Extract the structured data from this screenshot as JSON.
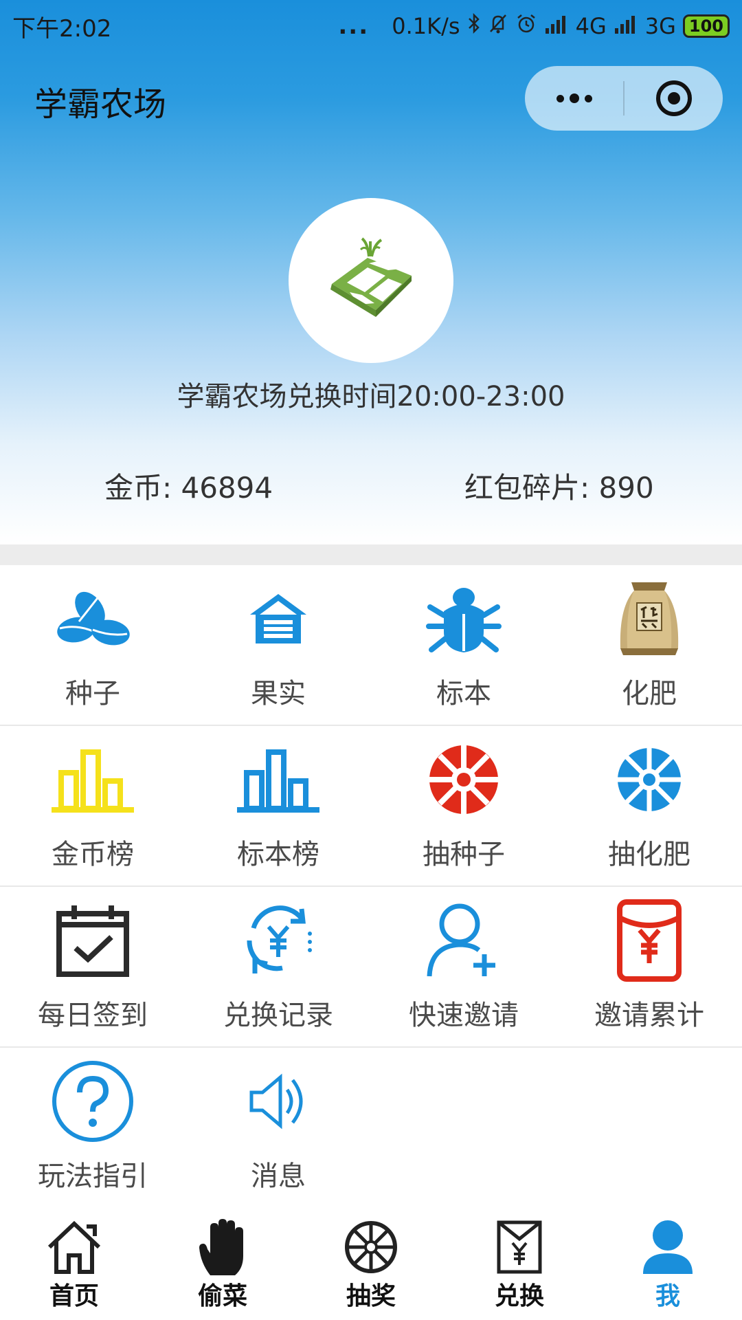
{
  "status_bar": {
    "time": "下午2:02",
    "dots": "...",
    "net_speed": "0.1K/s",
    "signal1": "4G",
    "signal2": "3G",
    "battery": "100"
  },
  "nav": {
    "title": "学霸农场"
  },
  "hero": {
    "exchange_time": "学霸农场兑换时间20:00-23:00",
    "coins": "金币: 46894",
    "red_packet": "红包碎片: 890"
  },
  "grid": {
    "rows": [
      [
        {
          "label": "种子",
          "icon": "seed-icon",
          "color": "#1a8fdb"
        },
        {
          "label": "果实",
          "icon": "barn-icon",
          "color": "#1a8fdb"
        },
        {
          "label": "标本",
          "icon": "bug-icon",
          "color": "#1a8fdb"
        },
        {
          "label": "化肥",
          "icon": "fertilizer-bag-icon",
          "color": "#b89a5c"
        }
      ],
      [
        {
          "label": "金币榜",
          "icon": "bar-chart-icon",
          "color": "#f5e11b"
        },
        {
          "label": "标本榜",
          "icon": "bar-chart-icon",
          "color": "#1a8fdb"
        },
        {
          "label": "抽种子",
          "icon": "wheel-icon",
          "color": "#e02b1a"
        },
        {
          "label": "抽化肥",
          "icon": "wheel-icon",
          "color": "#1a8fdb"
        }
      ],
      [
        {
          "label": "每日签到",
          "icon": "calendar-check-icon",
          "color": "#2b2b2b"
        },
        {
          "label": "兑换记录",
          "icon": "exchange-yuan-icon",
          "color": "#1a8fdb"
        },
        {
          "label": "快速邀请",
          "icon": "add-user-icon",
          "color": "#1a8fdb"
        },
        {
          "label": "邀请累计",
          "icon": "red-envelope-icon",
          "color": "#e02b1a"
        }
      ],
      [
        {
          "label": "玩法指引",
          "icon": "help-circle-icon",
          "color": "#1a8fdb"
        },
        {
          "label": "消息",
          "icon": "speaker-icon",
          "color": "#1a8fdb"
        }
      ]
    ]
  },
  "tabbar": {
    "items": [
      {
        "label": "首页",
        "icon": "home-icon"
      },
      {
        "label": "偷菜",
        "icon": "hand-icon"
      },
      {
        "label": "抽奖",
        "icon": "wheel-icon"
      },
      {
        "label": "兑换",
        "icon": "yuan-envelope-icon"
      },
      {
        "label": "我",
        "icon": "user-icon",
        "active": true
      }
    ],
    "active_color": "#1a8fdb"
  }
}
